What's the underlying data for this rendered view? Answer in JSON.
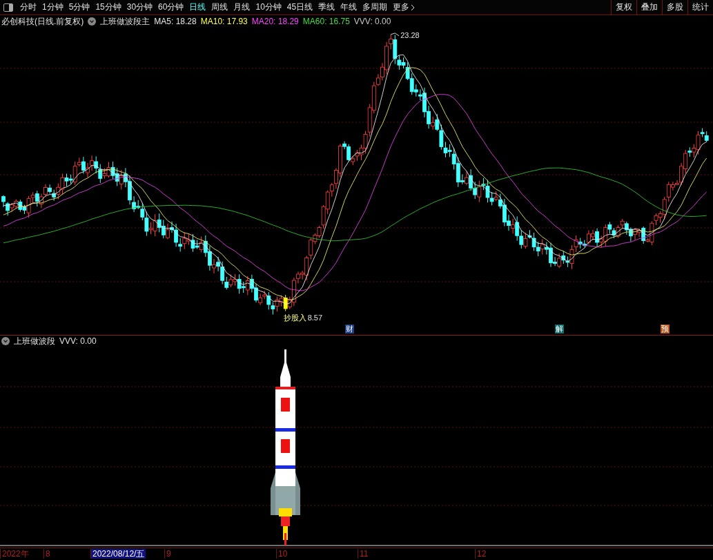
{
  "toolbar": {
    "periods": [
      {
        "label": "分时",
        "selected": false
      },
      {
        "label": "1分钟",
        "selected": false
      },
      {
        "label": "5分钟",
        "selected": false
      },
      {
        "label": "15分钟",
        "selected": false
      },
      {
        "label": "30分钟",
        "selected": false
      },
      {
        "label": "60分钟",
        "selected": false
      },
      {
        "label": "日线",
        "selected": true
      },
      {
        "label": "周线",
        "selected": false
      },
      {
        "label": "月线",
        "selected": false
      },
      {
        "label": "10分钟",
        "selected": false
      },
      {
        "label": "45日线",
        "selected": false
      },
      {
        "label": "季线",
        "selected": false
      },
      {
        "label": "年线",
        "selected": false
      },
      {
        "label": "多周期",
        "selected": false
      },
      {
        "label": "更多",
        "selected": false
      }
    ],
    "buttons": [
      "复权",
      "叠加",
      "多股",
      "统计"
    ]
  },
  "main_chart": {
    "stock": "必创科技(日线.前复权)",
    "indicator": "上班做波段主",
    "values": [
      {
        "label": "MA5: 18.28",
        "color": "#e8e8e8"
      },
      {
        "label": "MA10: 17.93",
        "color": "#ffff55"
      },
      {
        "label": "MA20: 18.29",
        "color": "#ff44ff"
      },
      {
        "label": "MA60: 16.75",
        "color": "#44dd44"
      },
      {
        "label": "VVV: 0.00",
        "color": "#c8c8c8"
      }
    ],
    "high_label": "23.28",
    "signal_label": "抄股入",
    "low_label": "8.57",
    "markers": [
      {
        "label": "财",
        "color": "#1c3f86"
      },
      {
        "label": "解",
        "color": "#0f6b6b"
      },
      {
        "label": "预",
        "color": "#b8541a"
      }
    ]
  },
  "sub_chart": {
    "indicator": "上班做波段",
    "value": "VVV: 0.00"
  },
  "time_axis": {
    "labels": [
      {
        "label": "2022年",
        "selected": false
      },
      {
        "label": "8",
        "selected": false
      },
      {
        "label": "2022/08/12/五",
        "selected": true
      },
      {
        "label": "9",
        "selected": false
      },
      {
        "label": "10",
        "selected": false
      },
      {
        "label": "11",
        "selected": false
      },
      {
        "label": "12",
        "selected": false
      }
    ]
  }
}
